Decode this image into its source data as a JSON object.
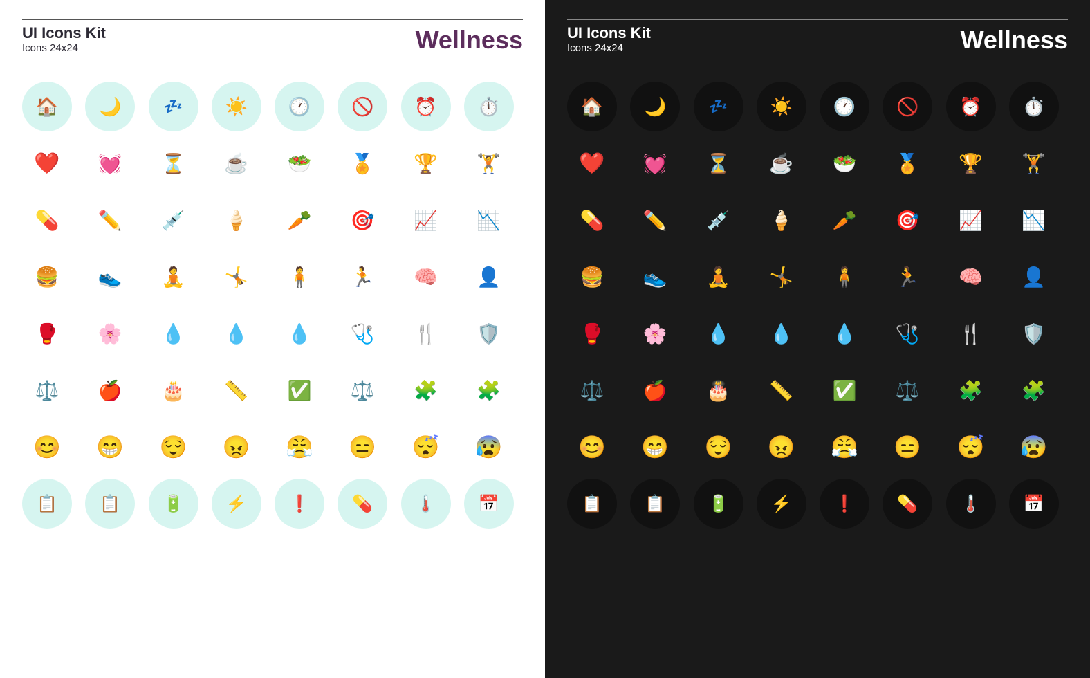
{
  "panels": [
    {
      "id": "light",
      "background": "#ffffff",
      "kitTitle": "UI Icons Kit",
      "kitSubtitle": "Icons 24x24",
      "wellnessLabel": "Wellness",
      "mode": "light"
    },
    {
      "id": "dark",
      "background": "#1a1a1a",
      "kitTitle": "UI Icons Kit",
      "kitSubtitle": "Icons 24x24",
      "wellnessLabel": "Wellness",
      "mode": "dark"
    }
  ],
  "iconRows": [
    [
      "🏠",
      "🌙",
      "💤",
      "☀️",
      "🕐",
      "🚫",
      "⏰",
      "⏱️"
    ],
    [
      "❤️",
      "💓",
      "⏳",
      "☕",
      "🥗",
      "🏅",
      "🏆",
      "🏋️"
    ],
    [
      "💊",
      "✏️",
      "💉",
      "🍦",
      "🥕",
      "🎯",
      "📈",
      "📉"
    ],
    [
      "🍔",
      "👟",
      "🧘",
      "🤸",
      "🧍",
      "🏃",
      "🧠",
      "👤"
    ],
    [
      "🥊",
      "🌸",
      "💧",
      "💧",
      "💧",
      "🩺",
      "🍴",
      "🛡️"
    ],
    [
      "⚖️",
      "🍎",
      "🎂",
      "📏",
      "✅",
      "⚖️",
      "🧩",
      "🧩"
    ],
    [
      "😊",
      "😁",
      "😌",
      "😠",
      "😤",
      "😑",
      "😴",
      "😰"
    ],
    [
      "📋",
      "📋",
      "🔋",
      "⚡",
      "❗",
      "💊",
      "🌡️",
      "📅"
    ]
  ],
  "labels": {
    "uiIconsKit": "UI Icons Kit",
    "icons24x24": "Icons 24x24",
    "wellness": "Wellness"
  }
}
